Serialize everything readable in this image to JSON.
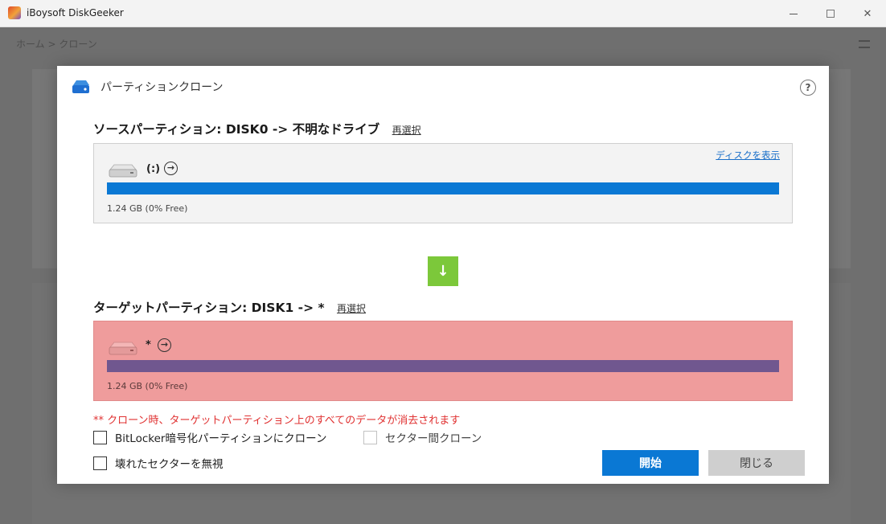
{
  "window": {
    "title": "iBoysoft DiskGeeker",
    "minimize_icon": "minimize-icon",
    "maximize_icon": "maximize-icon",
    "close_glyph": "✕"
  },
  "background": {
    "breadcrumb": "ホーム  >  クローン"
  },
  "dialog": {
    "title": "パーティションクローン",
    "help_glyph": "?",
    "source": {
      "title": "ソースパーティション: DISK0 -> 不明なドライブ",
      "rechoose_label": "再選択",
      "show_disk_link": "ディスクを表示",
      "drive_label": "(:)",
      "arrow_glyph": "→",
      "size_text": "1.24 GB (0% Free)",
      "used_fraction": 1.0,
      "bar_color": "#0a78d4"
    },
    "down_arrow_glyph": "↓",
    "target": {
      "title": "ターゲットパーティション: DISK1 -> *",
      "rechoose_label": "再選択",
      "drive_label": "*",
      "arrow_glyph": "→",
      "size_text": "1.24 GB (0% Free)",
      "used_fraction": 1.0,
      "bar_color": "#70578f",
      "box_color": "#ef9c9c"
    },
    "warning": "** クローン時、ターゲットパーティション上のすべてのデータが消去されます",
    "options": {
      "bitlocker_label": "BitLocker暗号化パーティションにクローン",
      "sector_label": "セクター間クローン",
      "ignore_bad_label": "壊れたセクターを無視"
    },
    "buttons": {
      "start": "開始",
      "close": "閉じる"
    }
  }
}
